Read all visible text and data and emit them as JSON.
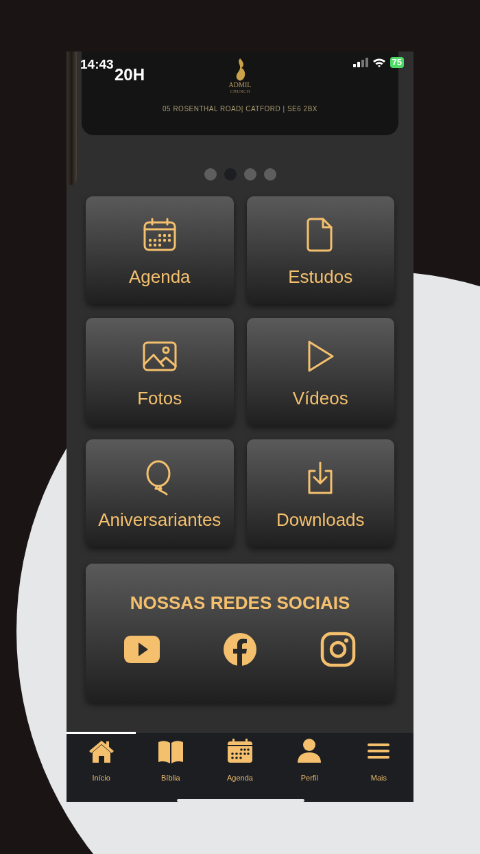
{
  "status_bar": {
    "time": "14:43",
    "battery": "75"
  },
  "banner": {
    "event_time": "20H",
    "logo_text": "ADMIL",
    "logo_subtext": "CHURCH",
    "address": "05 ROSENTHAL ROAD| CATFORD | SE6 2BX"
  },
  "carousel_dots": [
    {
      "selected": false
    },
    {
      "selected": true
    },
    {
      "selected": false
    },
    {
      "selected": false
    }
  ],
  "tiles": [
    {
      "label": "Agenda",
      "kind": "calendar"
    },
    {
      "label": "Estudos",
      "kind": "document"
    },
    {
      "label": "Fotos",
      "kind": "image"
    },
    {
      "label": "Vídeos",
      "kind": "play"
    },
    {
      "label": "Aniversariantes",
      "kind": "balloon"
    },
    {
      "label": "Downloads",
      "kind": "download"
    }
  ],
  "social": {
    "title": "NOSSAS REDES SOCIAIS",
    "links": [
      {
        "kind": "youtube"
      },
      {
        "kind": "facebook"
      },
      {
        "kind": "instagram"
      }
    ]
  },
  "tab_bar": [
    {
      "label": "Início",
      "kind": "home",
      "selected": true
    },
    {
      "label": "Bíblia",
      "kind": "book",
      "selected": false
    },
    {
      "label": "Agenda",
      "kind": "calendar",
      "selected": false
    },
    {
      "label": "Perfil",
      "kind": "person",
      "selected": false
    },
    {
      "label": "Mais",
      "kind": "menu",
      "selected": false
    }
  ]
}
